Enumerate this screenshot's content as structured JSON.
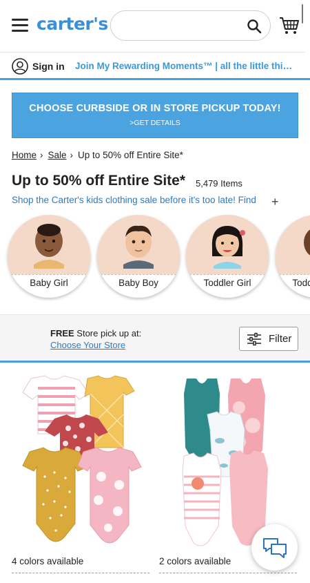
{
  "header": {
    "logo_text": "carter's",
    "search_placeholder": "",
    "accent_color": "#3a8fd6"
  },
  "signin_bar": {
    "signin_label": "Sign in",
    "promo_text": "Join My Rewarding Moments™ | all the little things"
  },
  "banner": {
    "title": "CHOOSE CURBSIDE OR IN STORE PICKUP TODAY!",
    "subtitle": ">GET DETAILS",
    "color": "#4ba3e0"
  },
  "breadcrumb": {
    "items": [
      "Home",
      "Sale"
    ],
    "current": "Up to 50% off Entire Site*"
  },
  "page": {
    "title": "Up to 50% off Entire Site*",
    "item_count": "5,479 Items",
    "description": "Shop the Carter's kids clothing sale before it's too late! Find"
  },
  "categories": [
    {
      "label": "Baby Girl",
      "icon": "baby-girl-photo"
    },
    {
      "label": "Baby Boy",
      "icon": "baby-boy-photo"
    },
    {
      "label": "Toddler Girl",
      "icon": "toddler-girl-photo"
    },
    {
      "label": "Toddler Boy",
      "icon": "toddler-boy-photo"
    }
  ],
  "store_bar": {
    "free_label": "FREE",
    "text": " Store pick up at:",
    "link": "Choose Your Store"
  },
  "filter": {
    "label": "Filter"
  },
  "products": [
    {
      "colors_text": "4 colors available"
    },
    {
      "colors_text": "2 colors available"
    }
  ]
}
